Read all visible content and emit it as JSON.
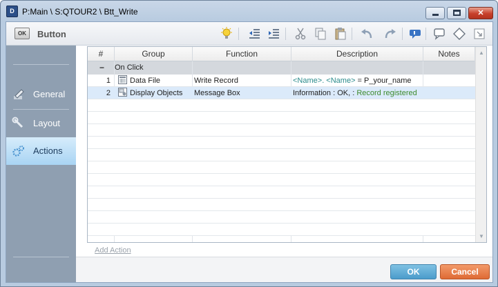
{
  "window": {
    "app_icon_text": "D",
    "title": "P:Main \\ S:QTOUR2 \\ Btt_Write"
  },
  "toolbar": {
    "object_icon_text": "OK",
    "object_type": "Button",
    "icons": [
      "lightbulb-icon",
      "outdent-icon",
      "indent-icon",
      "cut-icon",
      "copy-icon",
      "paste-icon",
      "undo-icon",
      "redo-icon",
      "comment-icon",
      "speech-bubble-icon",
      "tag-icon",
      "expand-icon"
    ]
  },
  "sidebar": {
    "items": [
      {
        "label": "General",
        "icon": "pencil-icon",
        "active": false
      },
      {
        "label": "Layout",
        "icon": "wrench-icon",
        "active": false
      },
      {
        "label": "Actions",
        "icon": "gears-icon",
        "active": true
      }
    ]
  },
  "grid": {
    "columns": [
      "#",
      "Group",
      "Function",
      "Description",
      "Notes"
    ],
    "group_label": "On Click",
    "rows": [
      {
        "num": "1",
        "group": "Data File",
        "group_icon": "data-file-icon",
        "function": "Write Record",
        "desc_part1": "<Name>. <Name>",
        "desc_part2": " = P_your_name",
        "selected": false
      },
      {
        "num": "2",
        "group": "Display Objects",
        "group_icon": "display-objects-icon",
        "function": "Message Box",
        "desc_part1": "Information : OK, : ",
        "desc_part2": "Record registered",
        "selected": true
      }
    ]
  },
  "add_action_label": "Add Action",
  "buttons": {
    "ok": "OK",
    "cancel": "Cancel"
  },
  "colors": {
    "ok": "#4b9ccb",
    "cancel": "#df6b35",
    "sidebar": "#8f9fb1",
    "selected_row": "#dbeafa"
  }
}
